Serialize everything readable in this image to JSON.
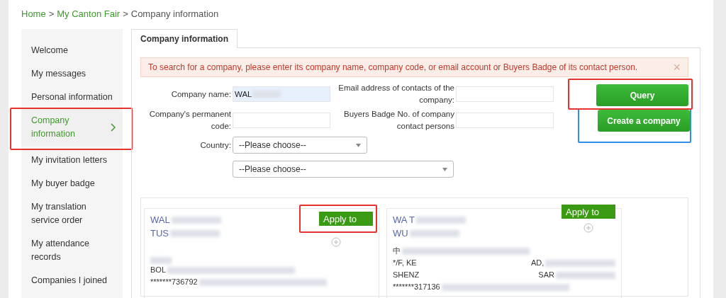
{
  "breadcrumb": {
    "separator": ">",
    "items": [
      {
        "label": "Home",
        "link": true
      },
      {
        "label": "My Canton Fair",
        "link": true
      },
      {
        "label": "Company information",
        "link": false
      }
    ]
  },
  "sidebar": {
    "items": [
      {
        "label": "Welcome",
        "selected": false
      },
      {
        "label": "My messages",
        "selected": false
      },
      {
        "label": "Personal information",
        "selected": false
      },
      {
        "label": "Company information",
        "selected": true,
        "color": "#e8322e"
      },
      {
        "label": "My invitation letters",
        "selected": false
      },
      {
        "label": "My buyer badge",
        "selected": false
      },
      {
        "label": "My translation service order",
        "selected": false
      },
      {
        "label": "My attendance records",
        "selected": false
      },
      {
        "label": "Companies I joined",
        "selected": false
      }
    ]
  },
  "tabs": [
    {
      "label": "Company information",
      "selected": true
    }
  ],
  "alert": {
    "text": "To search for a company, please enter its company name, company code, or email account or Buyers Badge of its contact person.",
    "close": "×"
  },
  "form": {
    "company_name": {
      "label": "Company name:",
      "value": "WAL"
    },
    "permanent_code": {
      "label": "Company's permanent code:"
    },
    "email": {
      "label": "Email address of contacts of the company:"
    },
    "badge": {
      "label": "Buyers Badge No. of company contact persons"
    },
    "country": {
      "label": "Country:",
      "value": "--Please choose--"
    },
    "region": {
      "value": "--Please choose--"
    }
  },
  "buttons": [
    {
      "label": "Query",
      "color": "#e8322e"
    },
    {
      "label": "Create a company",
      "color": "#2f8fe8"
    }
  ],
  "results": [
    {
      "name_lines": [
        "WAL",
        "TUS"
      ],
      "address_lines": [
        "BOL",
        "*******736792"
      ],
      "apply": "Apply to",
      "color": "#e8322e"
    },
    {
      "name_lines": [
        "WA          T",
        "WU"
      ],
      "address_lines": [
        "中",
        "*/F, KE                                                     AD,",
        "SHENZ                                                       SAR",
        "*******317136"
      ],
      "apply": "Apply to"
    }
  ]
}
